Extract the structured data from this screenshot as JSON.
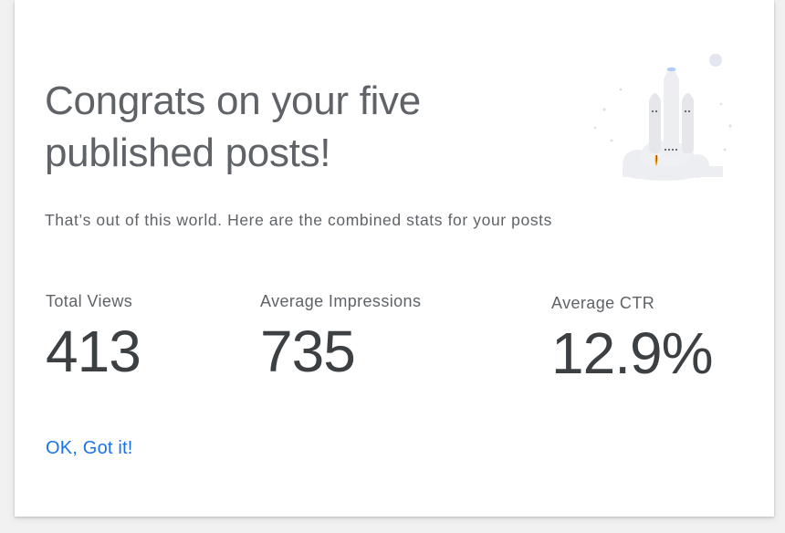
{
  "dialog": {
    "title_line1": "Congrats on your five",
    "title_line2": "published posts!",
    "subtitle": "That’s out of this world. Here are the combined stats for your posts",
    "illustration_icon": "rocket-launch-icon",
    "stats": [
      {
        "label": "Total Views",
        "value": "413"
      },
      {
        "label": "Average Impressions",
        "value": "735"
      },
      {
        "label": "Average CTR",
        "value": "12.9%"
      }
    ],
    "ok_label": "OK, Got it!"
  },
  "colors": {
    "background": "#f1f1f1",
    "card": "#ffffff",
    "text_secondary": "#5f6368",
    "text_primary": "#3c4043",
    "accent": "#1a73e8",
    "illustration": "#e8eaed"
  }
}
